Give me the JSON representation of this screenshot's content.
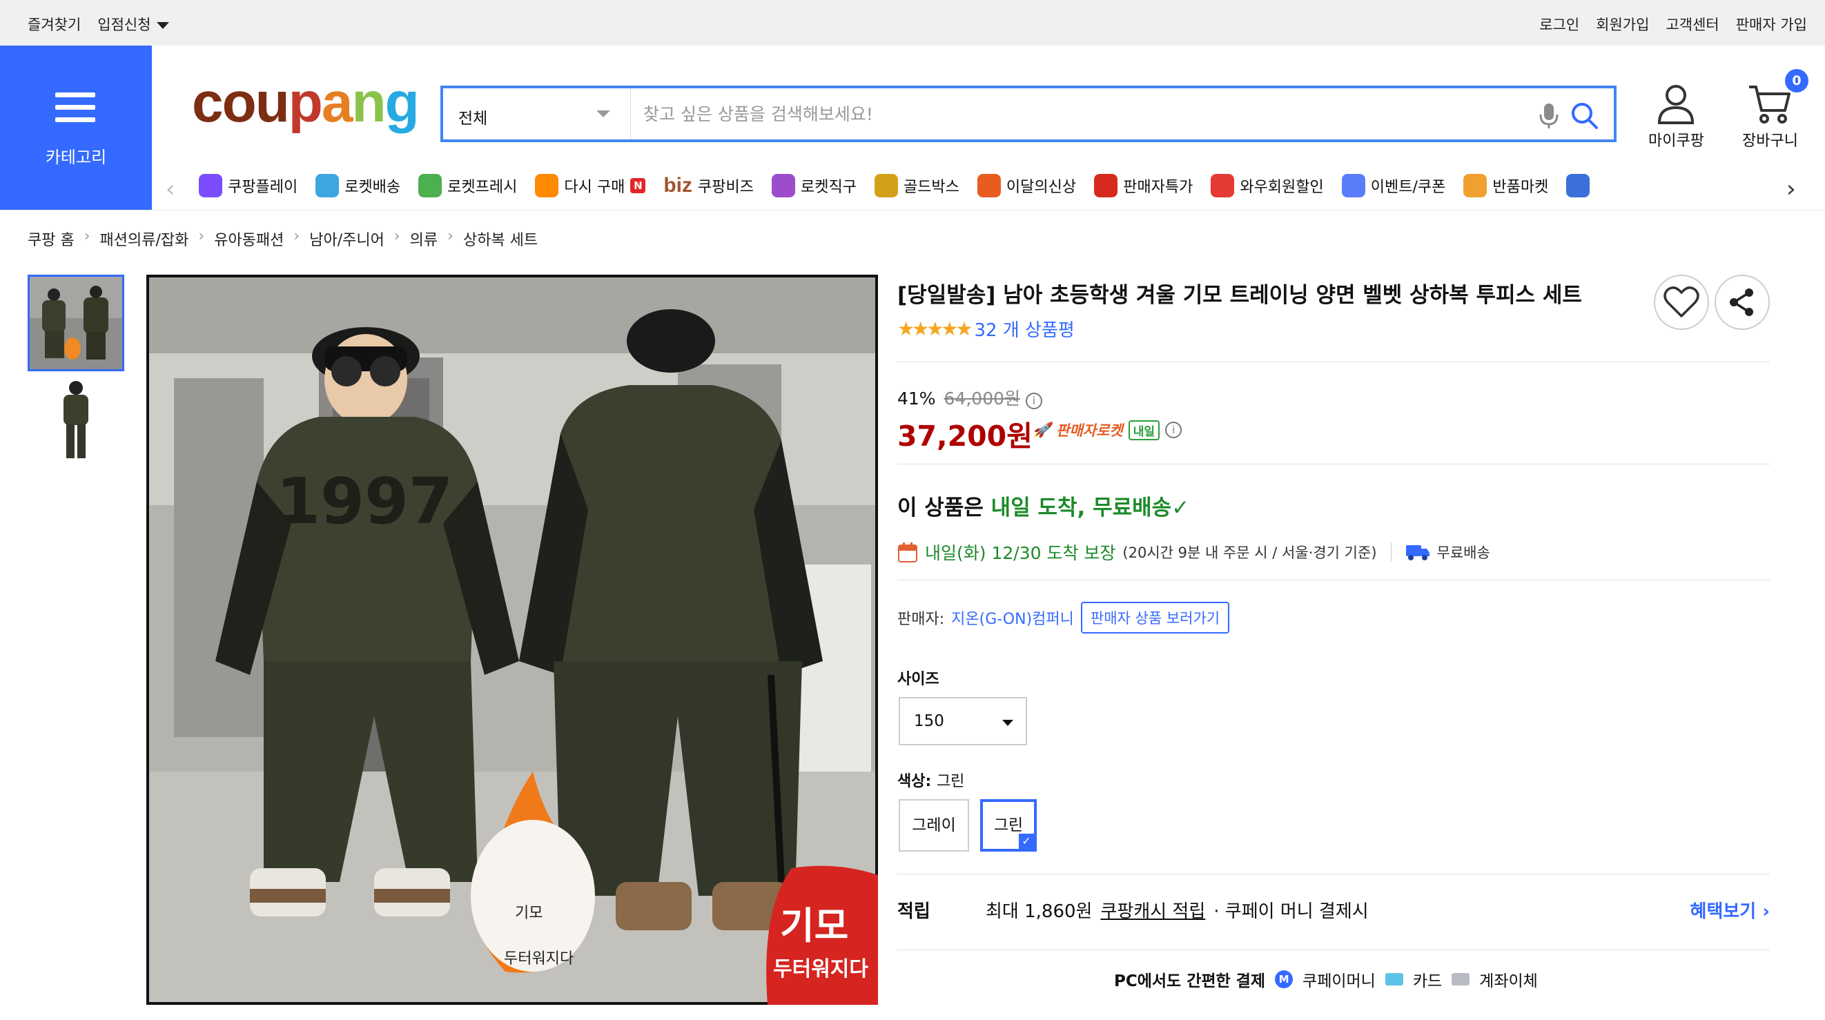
{
  "topbar": {
    "left": [
      "즐겨찾기",
      "입점신청"
    ],
    "right": [
      "로그인",
      "회원가입",
      "고객센터",
      "판매자 가입"
    ]
  },
  "category_label": "카테고리",
  "logo": {
    "c": "c",
    "o": "o",
    "u": "u",
    "p": "p",
    "a": "a",
    "n": "n",
    "g": "g"
  },
  "search": {
    "scope": "전체",
    "placeholder": "찾고 싶은 상품을 검색해보세요!"
  },
  "header_icons": {
    "mycoupang": "마이쿠팡",
    "cart": "장바구니",
    "cart_count": "0"
  },
  "nav": [
    {
      "label": "쿠팡플레이",
      "icon": "play-icon",
      "color": "#7b4dff"
    },
    {
      "label": "로켓배송",
      "icon": "rocket-icon",
      "color": "#3da5e0"
    },
    {
      "label": "로켓프레시",
      "icon": "fresh-rocket-icon",
      "color": "#4caf50"
    },
    {
      "label": "다시 구매",
      "icon": "basket-icon",
      "color": "#ff8a00",
      "badge": "N"
    },
    {
      "label": "쿠팡비즈",
      "icon": "biz-icon",
      "prefix": "biz"
    },
    {
      "label": "로켓직구",
      "icon": "global-rocket-icon",
      "color": "#9c4dcc"
    },
    {
      "label": "골드박스",
      "icon": "goldbox-icon",
      "color": "#d4a017"
    },
    {
      "label": "이달의신상",
      "icon": "new-bag-icon",
      "color": "#e85d1f"
    },
    {
      "label": "판매자특가",
      "icon": "percent-icon",
      "color": "#d62a1e"
    },
    {
      "label": "와우회원할인",
      "icon": "wow-icon",
      "color": "#e53935"
    },
    {
      "label": "이벤트/쿠폰",
      "icon": "coupon-icon",
      "color": "#5b7cfa"
    },
    {
      "label": "반품마켓",
      "icon": "return-market-icon",
      "color": "#f0a030"
    },
    {
      "label": "",
      "icon": "store-icon",
      "color": "#3b6fd9"
    }
  ],
  "breadcrumb": [
    "쿠팡 홈",
    "패션의류/잡화",
    "유아동패션",
    "남아/주니어",
    "의류",
    "상하복 세트"
  ],
  "image_overlay": {
    "badge_big": "기모",
    "badge_small": "두터워지다",
    "flame_top": "기모",
    "flame_bottom": "두터워지다",
    "print_number": "1997"
  },
  "product": {
    "title": "[당일발송] 남아 초등학생 겨울 기모 트레이닝 양면 벨벳 상하복 투피스 세트",
    "rating_stars": 5,
    "review_count": "32 개 상품평",
    "discount": "41%",
    "original_price": "64,000원",
    "price": "37,200원",
    "rocket_label": "판매자로켓",
    "rocket_tag": "내일",
    "arrival_prefix": "이 상품은 ",
    "arrival_highlight": "내일 도착, 무료배송",
    "delivery_date": "내일(화) 12/30 도착 보장",
    "delivery_note": "(20시간 9분 내 주문 시 / 서울·경기 기준)",
    "free_shipping": "무료배송",
    "seller_label": "판매자: ",
    "seller_name": "지온(G-ON)컴퍼니",
    "seller_button": "판매자 상품 보러가기",
    "size_label": "사이즈",
    "size_value": "150",
    "color_label": "색상: ",
    "color_value": "그린",
    "colors": [
      "그레이",
      "그린"
    ],
    "points_label": "적립",
    "points_max": "최대 1,860원",
    "points_link": "쿠팡캐시 적립",
    "points_note": "· 쿠페이 머니 결제시",
    "benefit_link": "혜택보기",
    "pay_heading": "PC에서도 간편한 결제",
    "pay_methods": [
      "쿠페이머니",
      "카드",
      "계좌이체"
    ]
  },
  "colors": {
    "accent": "#346aff",
    "price": "#ae0000",
    "green": "#1d8a2a",
    "star": "#f5a623"
  }
}
